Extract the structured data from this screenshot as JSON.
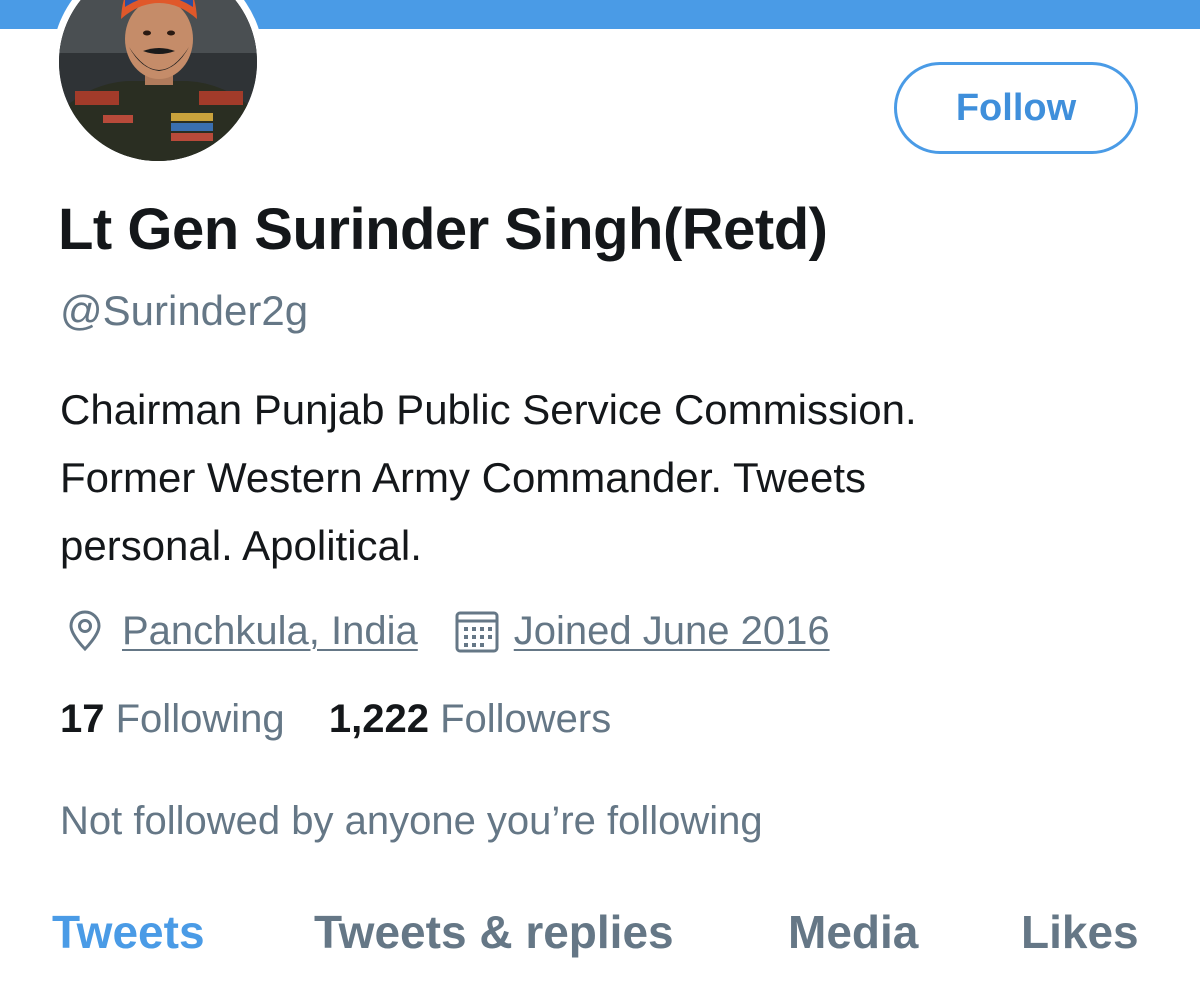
{
  "profile": {
    "display_name": "Lt Gen Surinder Singh(Retd)",
    "handle": "@Surinder2g",
    "bio_lines": [
      "Chairman Punjab Public Service Commission.",
      "Former Western Army Commander. Tweets",
      "personal. Apolitical."
    ],
    "location": "Panchkula, India",
    "joined": "Joined June 2016",
    "following_count": "17",
    "following_label": "Following",
    "followers_count": "1,222",
    "followers_label": "Followers",
    "mutual_note": "Not followed by anyone you’re following"
  },
  "actions": {
    "follow_label": "Follow"
  },
  "tabs": [
    {
      "label": "Tweets",
      "active": true
    },
    {
      "label": "Tweets & replies",
      "active": false
    },
    {
      "label": "Media",
      "active": false
    },
    {
      "label": "Likes",
      "active": false
    }
  ],
  "icons": {
    "location": "location-pin-icon",
    "joined": "calendar-icon"
  },
  "colors": {
    "accent": "#4a9be6",
    "text_primary": "#14171a",
    "text_secondary": "#657786"
  }
}
